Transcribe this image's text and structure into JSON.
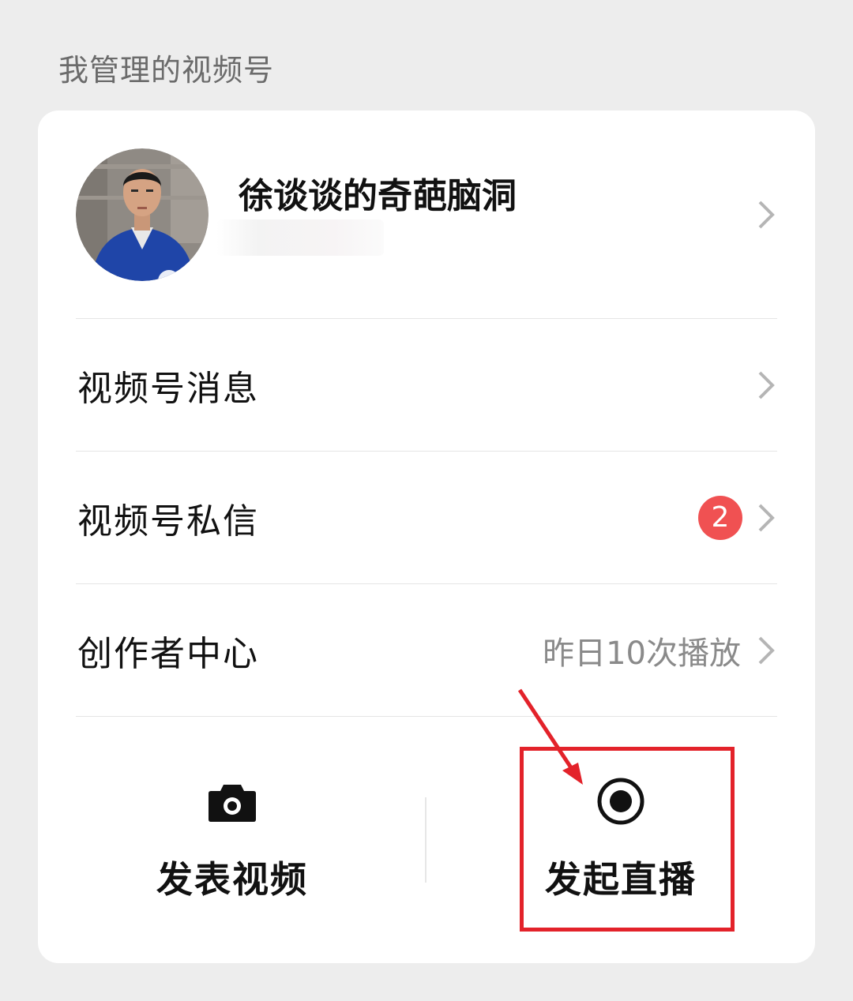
{
  "section": {
    "title": "我管理的视频号"
  },
  "profile": {
    "name": "徐谈谈的奇葩脑洞",
    "avatar_icon": "avatar-photo",
    "chevron_icon": "chevron-right-icon"
  },
  "menu": [
    {
      "label": "视频号消息",
      "right_text": "",
      "badge": ""
    },
    {
      "label": "视频号私信",
      "right_text": "",
      "badge": "2"
    },
    {
      "label": "创作者中心",
      "right_text": "昨日10次播放",
      "badge": ""
    }
  ],
  "actions": {
    "publish": {
      "label": "发表视频",
      "icon": "camera-icon"
    },
    "live": {
      "label": "发起直播",
      "icon": "live-record-icon"
    }
  },
  "colors": {
    "background": "#ededed",
    "card": "#ffffff",
    "badge": "#f05152",
    "highlight": "#e3222a"
  }
}
